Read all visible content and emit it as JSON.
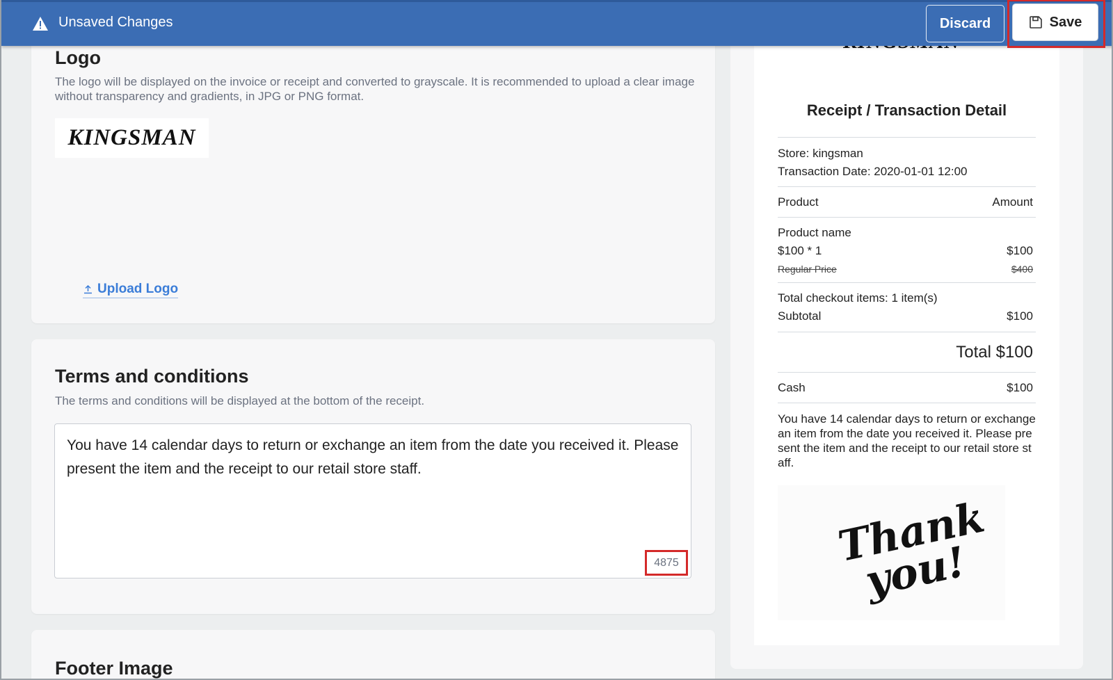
{
  "topbar": {
    "title": "Unsaved Changes",
    "discard_label": "Discard",
    "save_label": "Save",
    "color": "#3b6db4"
  },
  "logo_section": {
    "title": "Logo",
    "description": "The logo will be displayed on the invoice or receipt and converted to grayscale. It is recommended to upload a clear image without transparency and gradients, in JPG or PNG format.",
    "logo_text": "KINGSMAN",
    "upload_label": "Upload Logo"
  },
  "terms_section": {
    "title": "Terms and conditions",
    "description": "The terms and conditions will be displayed at the bottom of the receipt.",
    "value": "You have 14 calendar days to return or exchange an item from the date you received it. Please present the item and the receipt to our retail store staff.",
    "counter": "4875"
  },
  "footer_section": {
    "title": "Footer Image"
  },
  "receipt": {
    "logo_text": "KINGSMAN",
    "title": "Receipt / Transaction Detail",
    "store": "Store: kingsman",
    "date": "Transaction Date: 2020-01-01 12:00",
    "col_product": "Product",
    "col_amount": "Amount",
    "product_name": "Product name",
    "qty_line": "$100 * 1",
    "qty_amount": "$100",
    "regular_price_label": "Regular Price",
    "regular_price": "$400",
    "checkout_items": "Total checkout items: 1 item(s)",
    "subtotal_label": "Subtotal",
    "subtotal": "$100",
    "total": "Total $100",
    "payment_label": "Cash",
    "payment_amount": "$100",
    "terms": "You have 14 calendar days to return or exchange an item from the date you received it. Please present the item and the receipt to our retail store staff.",
    "footer_image_text": "Thank you!"
  },
  "icons": {
    "warning": "warning-icon",
    "save": "floppy-disk-icon",
    "upload": "upload-icon"
  }
}
